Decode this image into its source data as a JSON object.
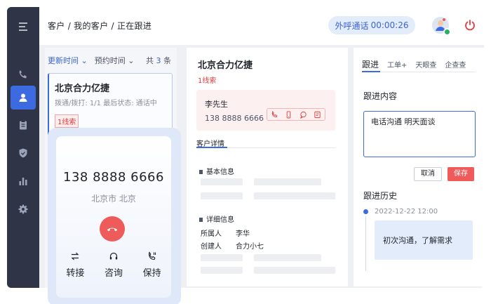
{
  "header": {
    "breadcrumb": "客户 / 我的客户 / 正在跟进",
    "call_label": "外呼通话",
    "call_timer": "00:00:26"
  },
  "sidebar": {
    "items": [
      {
        "icon": "menu-icon"
      },
      {
        "icon": "phone-icon"
      },
      {
        "icon": "user-icon",
        "active": true
      },
      {
        "icon": "clipboard-icon"
      },
      {
        "icon": "shield-icon"
      },
      {
        "icon": "bar-chart-icon"
      },
      {
        "icon": "gear-icon"
      }
    ]
  },
  "list": {
    "sort_primary": "更新时间",
    "sort_secondary": "预约时间",
    "count_prefix": "共",
    "count": "3",
    "count_suffix": "条",
    "card": {
      "name": "北京合力亿捷",
      "meta": "拨通/拨打:   1/1   最后状态: 通话中",
      "tag": "1线索"
    }
  },
  "call": {
    "number": "138 8888 6666",
    "location": "北京市 北京",
    "actions": [
      {
        "label": "转接",
        "icon": "transfer-icon"
      },
      {
        "label": "咨询",
        "icon": "headset-icon"
      },
      {
        "label": "保持",
        "icon": "hold-icon"
      }
    ]
  },
  "detail": {
    "title": "北京合力亿捷",
    "leads": "1线索",
    "contact_name": "李先生",
    "contact_phone": "138 8888 6666",
    "tab": "客户详情",
    "basic_section": "基本信息",
    "detail_section": "详细信息",
    "owner_label": "所属人",
    "owner_value": "李华",
    "creator_label": "创建人",
    "creator_value": "合力小七"
  },
  "followup": {
    "tabs": [
      "跟进",
      "工单+",
      "天眼查",
      "企查查"
    ],
    "content_label": "跟进内容",
    "content_value": "电话沟通 明天面谈",
    "cancel": "取消",
    "save": "保存",
    "history_label": "跟进历史",
    "history_date": "2022-12-22 12:00",
    "history_text": "初次沟通，了解需求"
  },
  "colors": {
    "accent": "#3c6ae0",
    "sidebar": "#2f3547",
    "danger": "#ef5a5a"
  }
}
